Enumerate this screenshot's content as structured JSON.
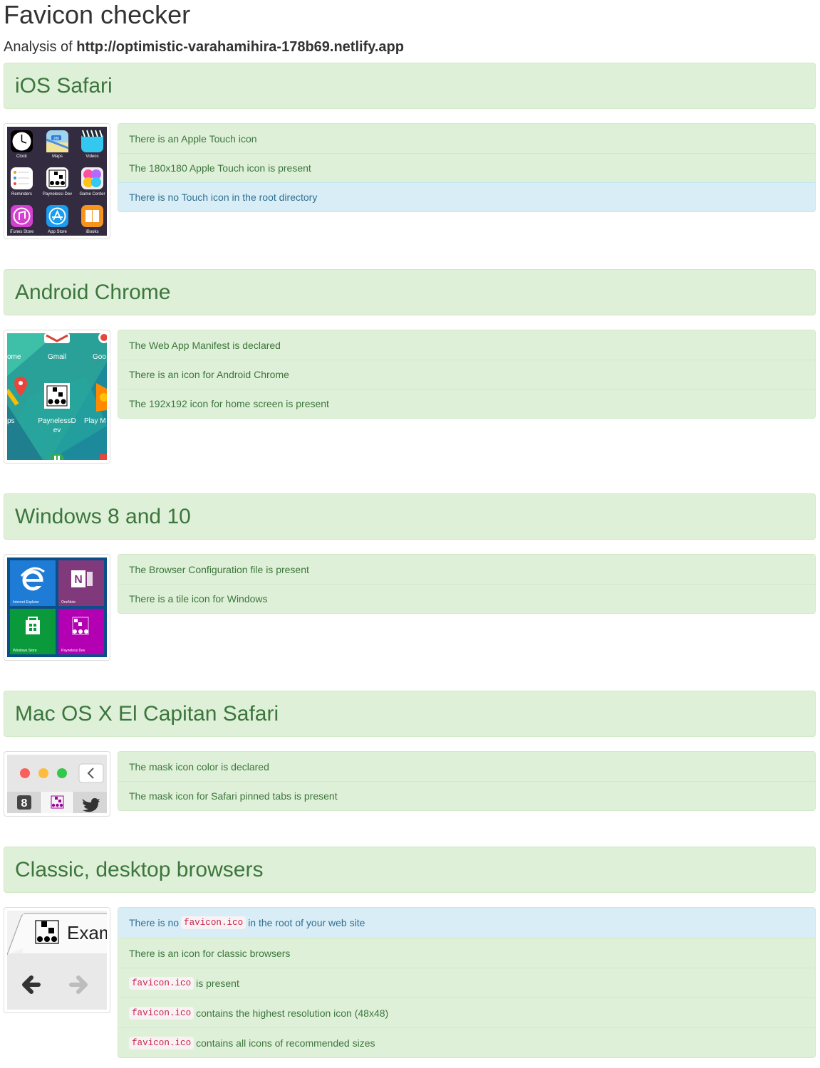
{
  "header": {
    "title": "Favicon checker",
    "analysis_prefix": "Analysis of ",
    "analysis_url": "http://optimistic-varahamihira-178b69.netlify.app"
  },
  "sections": [
    {
      "title": "iOS Safari",
      "thumbnail": {
        "labels": [
          "Clock",
          "Maps",
          "Videos",
          "Reminders",
          "Paynelessi Dev",
          "Game Center",
          "iTunes Store",
          "App Store",
          "iBooks"
        ],
        "badge": "280"
      },
      "items": [
        {
          "text": "There is an Apple Touch icon",
          "status": "success"
        },
        {
          "text": "The 180x180 Apple Touch icon is present",
          "status": "success"
        },
        {
          "text": "There is no Touch icon in the root directory",
          "status": "info"
        }
      ]
    },
    {
      "title": "Android Chrome",
      "thumbnail": {
        "labels": [
          "ome",
          "Gmail",
          "Goo",
          "ps",
          "PaynelessD",
          "ev",
          "Play M"
        ]
      },
      "items": [
        {
          "text": "The Web App Manifest is declared",
          "status": "success"
        },
        {
          "text": "There is an icon for Android Chrome",
          "status": "success"
        },
        {
          "text": "The 192x192 icon for home screen is present",
          "status": "success"
        }
      ]
    },
    {
      "title": "Windows 8 and 10",
      "thumbnail": {
        "labels": [
          "Internet Explorer",
          "OneNote",
          "Windows Store",
          "Payneless Dev"
        ],
        "onenote_letter": "N"
      },
      "items": [
        {
          "text": "The Browser Configuration file is present",
          "status": "success"
        },
        {
          "text": "There is a tile icon for Windows",
          "status": "success"
        }
      ]
    },
    {
      "title": "Mac OS X El Capitan Safari",
      "thumbnail": {
        "first_tab_glyph": "8"
      },
      "items": [
        {
          "text": "The mask icon color is declared",
          "status": "success"
        },
        {
          "text": "The mask icon for Safari pinned tabs is present",
          "status": "success"
        }
      ]
    },
    {
      "title": "Classic, desktop browsers",
      "thumbnail": {
        "tab_text": "Exam"
      },
      "items": [
        {
          "pre": "There is no ",
          "code": "favicon.ico",
          "post": " in the root of your web site",
          "status": "info"
        },
        {
          "text": "There is an icon for classic browsers",
          "status": "success"
        },
        {
          "code": "favicon.ico",
          "post": " is present",
          "status": "success"
        },
        {
          "code": "favicon.ico",
          "post": " contains the highest resolution icon (48x48)",
          "status": "success"
        },
        {
          "code": "favicon.ico",
          "post": " contains all icons of recommended sizes",
          "status": "success"
        }
      ]
    }
  ],
  "colors": {
    "success_bg": "#dff0d8",
    "success_text": "#3c763d",
    "info_bg": "#d9edf7",
    "info_text": "#31708f",
    "code_text": "#c7254e"
  }
}
